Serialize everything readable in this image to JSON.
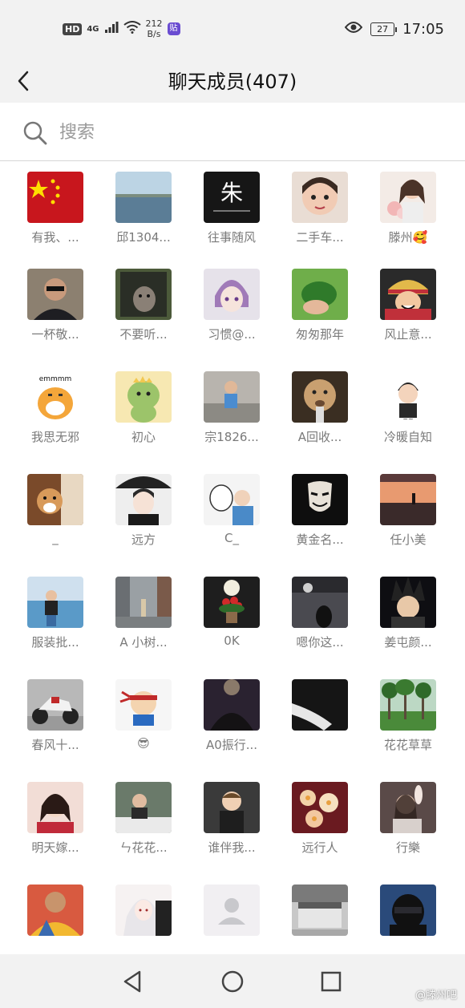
{
  "status_bar": {
    "hd": "HD",
    "network": "4G",
    "speed_value": "212",
    "speed_unit": "B/s",
    "notify_app": "贴",
    "battery": "27",
    "time": "17:05"
  },
  "header": {
    "title": "聊天成员(407)"
  },
  "search": {
    "placeholder": "搜索",
    "value": ""
  },
  "members": [
    {
      "name": "有我、...",
      "avatar": "flag"
    },
    {
      "name": "邱1304...",
      "avatar": "sea"
    },
    {
      "name": "往事随风",
      "avatar": "calligraphy"
    },
    {
      "name": "二手车...",
      "avatar": "child-face"
    },
    {
      "name": "滕州🥰",
      "avatar": "girl-flowers"
    },
    {
      "name": "一杯敬...",
      "avatar": "old-man"
    },
    {
      "name": "不要听...",
      "avatar": "cat-window"
    },
    {
      "name": "习惯@...",
      "avatar": "anime-boy"
    },
    {
      "name": "匆匆那年",
      "avatar": "leaf-hand"
    },
    {
      "name": "风止意...",
      "avatar": "one-piece"
    },
    {
      "name": "我思无邪",
      "avatar": "tiger-cartoon"
    },
    {
      "name": "初心",
      "avatar": "dino-cartoon"
    },
    {
      "name": "宗1826...",
      "avatar": "kid-bike"
    },
    {
      "name": "A回收...",
      "avatar": "lion-cub"
    },
    {
      "name": "冷暖自知",
      "avatar": "cartoon-boy"
    },
    {
      "name": "_",
      "avatar": "shiba"
    },
    {
      "name": "远方",
      "avatar": "anime-umbrella"
    },
    {
      "name": "C_",
      "avatar": "sketch-boy"
    },
    {
      "name": "黄金名...",
      "avatar": "mask"
    },
    {
      "name": "任小美",
      "avatar": "sunset-lake"
    },
    {
      "name": "服装批...",
      "avatar": "girl-sea"
    },
    {
      "name": "A 小树...",
      "avatar": "street"
    },
    {
      "name": "0K",
      "avatar": "flower-lamp"
    },
    {
      "name": "嗯你这...",
      "avatar": "night-city"
    },
    {
      "name": "姜屯颜...",
      "avatar": "goku"
    },
    {
      "name": "春风十...",
      "avatar": "motorbike"
    },
    {
      "name": "😎",
      "avatar": "ninja-cartoon"
    },
    {
      "name": "A0振行...",
      "avatar": "dark-shirt"
    },
    {
      "name": "",
      "avatar": "arm-dark"
    },
    {
      "name": "花花草草",
      "avatar": "forest"
    },
    {
      "name": "明天嫁...",
      "avatar": "girl-red"
    },
    {
      "name": "ㄣ花花...",
      "avatar": "boy-piano"
    },
    {
      "name": "谁伴我...",
      "avatar": "toddler"
    },
    {
      "name": "远行人",
      "avatar": "plumeria"
    },
    {
      "name": "行樂",
      "avatar": "girl-bunny"
    },
    {
      "name": "",
      "avatar": "man-colorful"
    },
    {
      "name": "",
      "avatar": "anime-white-hair"
    },
    {
      "name": "",
      "avatar": "default-person"
    },
    {
      "name": "",
      "avatar": "bedroom"
    },
    {
      "name": "",
      "avatar": "helmet"
    }
  ],
  "watermark": "@滕州吧",
  "colors": {
    "bar_bg": "#f2f2f2",
    "name_text": "#7a7a7a",
    "title_text": "#111111"
  }
}
